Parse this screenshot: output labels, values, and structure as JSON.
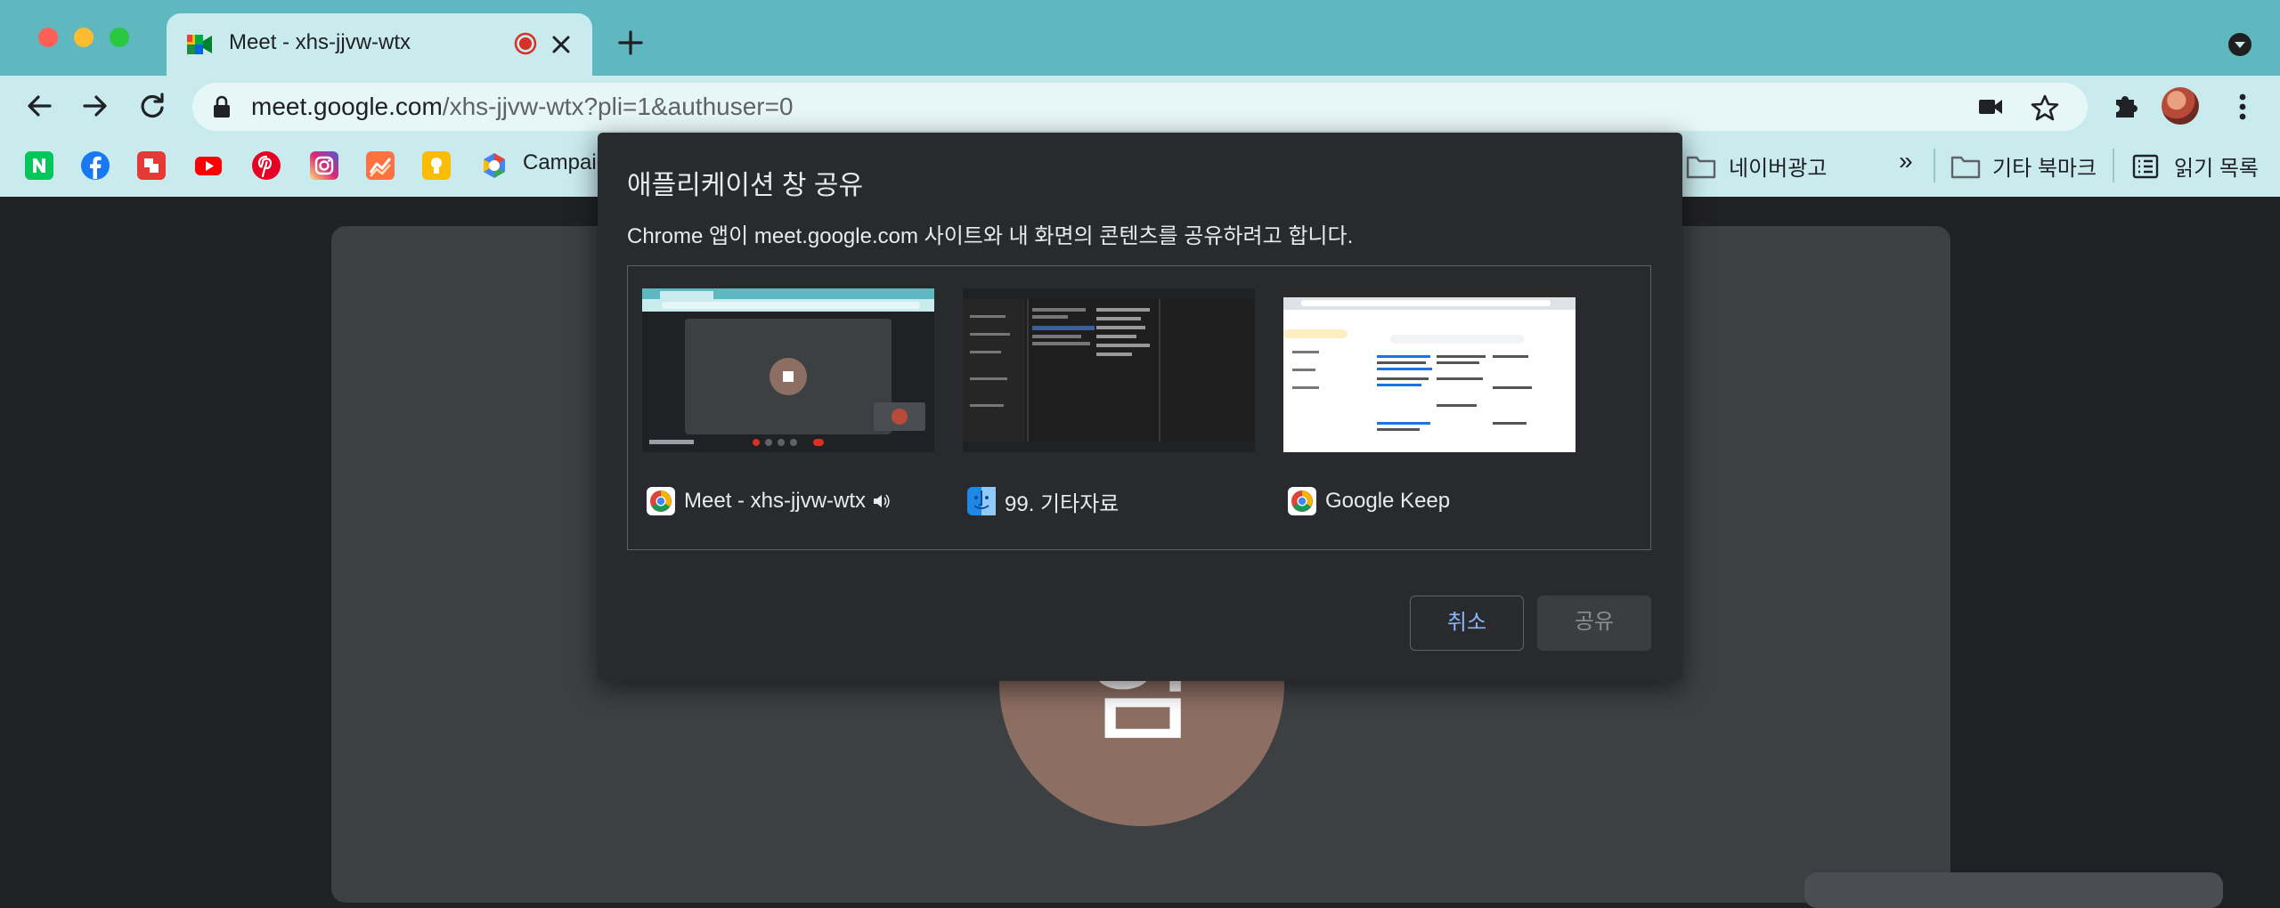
{
  "browser": {
    "tab": {
      "title": "Meet - xhs-jjvw-wtx"
    },
    "address": {
      "host": "meet.google.com",
      "path": "/xhs-jjvw-wtx?pli=1&authuser=0"
    }
  },
  "bookmarks": {
    "items": [
      {
        "icon": "naver-icon",
        "color": "#03c75a"
      },
      {
        "icon": "facebook-icon",
        "color": "#1877f2"
      },
      {
        "icon": "red-app-icon",
        "color": "#e53935"
      },
      {
        "icon": "youtube-icon",
        "color": "#ff0000"
      },
      {
        "icon": "pinterest-icon",
        "color": "#e60023"
      },
      {
        "icon": "instagram-icon",
        "color": "#c13584"
      },
      {
        "icon": "analytics-icon",
        "color": "#ff7043"
      },
      {
        "icon": "keep-icon",
        "color": "#fbbc04"
      },
      {
        "icon": "campaign-icon",
        "color": "#4285f4",
        "label": "Campai"
      }
    ],
    "folder_naver_ads": "네이버광고",
    "overflow": "»",
    "other_bookmarks": "기타 북마크",
    "reading_list": "읽기 목록"
  },
  "meet": {
    "avatar_letter": "함"
  },
  "dialog": {
    "title": "애플리케이션 창 공유",
    "description": "Chrome 앱이 meet.google.com 사이트와 내 화면의 콘텐츠를 공유하려고 합니다.",
    "windows": [
      {
        "label": "Meet - xhs-jjvw-wtx",
        "app": "chrome-icon",
        "audio": true
      },
      {
        "label": "99. 기타자료",
        "app": "finder-icon",
        "audio": false
      },
      {
        "label": "Google Keep",
        "app": "chrome-icon",
        "audio": false
      }
    ],
    "cancel_label": "취소",
    "share_label": "공유"
  },
  "colors": {
    "tabstrip": "#5fb7bf",
    "toolbar": "#c9ebee",
    "dialog_bg": "#292a2d",
    "cancel_text": "#8ab4f8",
    "avatar": "#8d6e63"
  }
}
